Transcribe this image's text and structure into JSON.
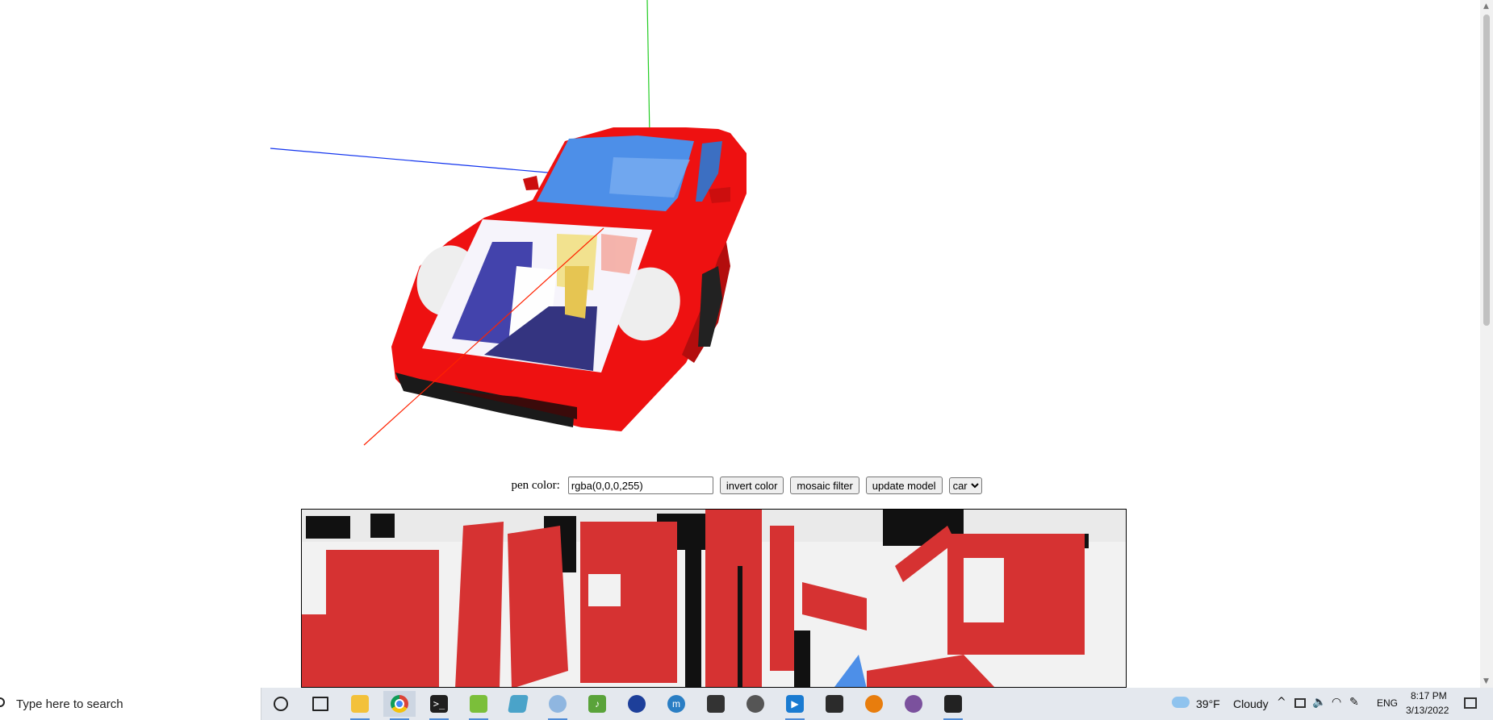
{
  "controls": {
    "pen_label": "pen color:",
    "pen_value": "rgba(0,0,0,255)",
    "invert_label": "invert color",
    "mosaic_label": "mosaic filter",
    "update_label": "update model",
    "model_selected": "car"
  },
  "colors": {
    "car_body": "#ee1111",
    "windshield": "#4d8fe8",
    "texture_red": "#d63232",
    "axis_x": "#ff2200",
    "axis_y": "#22cc22",
    "axis_z": "#1133ee"
  },
  "taskbar": {
    "search_placeholder": "Type here to search",
    "apps": [
      {
        "name": "cortana-icon"
      },
      {
        "name": "task-view-icon"
      },
      {
        "name": "file-explorer-icon"
      },
      {
        "name": "chrome-icon"
      },
      {
        "name": "terminal-icon"
      },
      {
        "name": "notepad-plus-icon"
      },
      {
        "name": "notes-icon"
      },
      {
        "name": "paint-icon"
      },
      {
        "name": "music-icon"
      },
      {
        "name": "vpn-icon"
      },
      {
        "name": "musescore-icon"
      },
      {
        "name": "camera-icon"
      },
      {
        "name": "media-player-icon"
      },
      {
        "name": "photos-icon"
      },
      {
        "name": "console-icon"
      },
      {
        "name": "blender-icon"
      },
      {
        "name": "viber-icon"
      },
      {
        "name": "unity-icon"
      }
    ],
    "weather_temp": "39°F",
    "weather_desc": "Cloudy",
    "language": "ENG",
    "time": "8:17 PM",
    "date": "3/13/2022"
  }
}
